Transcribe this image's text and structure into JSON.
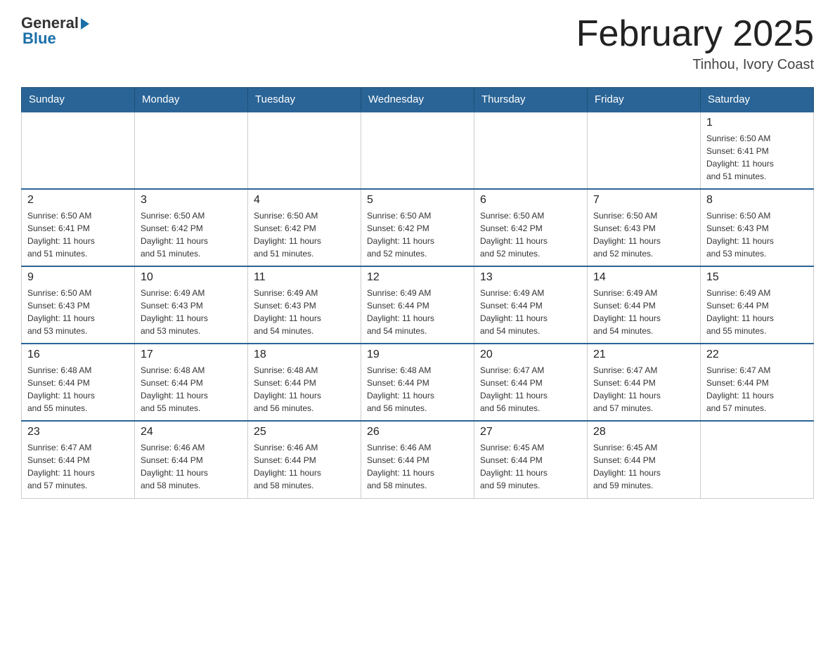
{
  "logo": {
    "general": "General",
    "blue": "Blue"
  },
  "title": "February 2025",
  "location": "Tinhou, Ivory Coast",
  "days_of_week": [
    "Sunday",
    "Monday",
    "Tuesday",
    "Wednesday",
    "Thursday",
    "Friday",
    "Saturday"
  ],
  "weeks": [
    [
      {
        "day": "",
        "info": ""
      },
      {
        "day": "",
        "info": ""
      },
      {
        "day": "",
        "info": ""
      },
      {
        "day": "",
        "info": ""
      },
      {
        "day": "",
        "info": ""
      },
      {
        "day": "",
        "info": ""
      },
      {
        "day": "1",
        "info": "Sunrise: 6:50 AM\nSunset: 6:41 PM\nDaylight: 11 hours\nand 51 minutes."
      }
    ],
    [
      {
        "day": "2",
        "info": "Sunrise: 6:50 AM\nSunset: 6:41 PM\nDaylight: 11 hours\nand 51 minutes."
      },
      {
        "day": "3",
        "info": "Sunrise: 6:50 AM\nSunset: 6:42 PM\nDaylight: 11 hours\nand 51 minutes."
      },
      {
        "day": "4",
        "info": "Sunrise: 6:50 AM\nSunset: 6:42 PM\nDaylight: 11 hours\nand 51 minutes."
      },
      {
        "day": "5",
        "info": "Sunrise: 6:50 AM\nSunset: 6:42 PM\nDaylight: 11 hours\nand 52 minutes."
      },
      {
        "day": "6",
        "info": "Sunrise: 6:50 AM\nSunset: 6:42 PM\nDaylight: 11 hours\nand 52 minutes."
      },
      {
        "day": "7",
        "info": "Sunrise: 6:50 AM\nSunset: 6:43 PM\nDaylight: 11 hours\nand 52 minutes."
      },
      {
        "day": "8",
        "info": "Sunrise: 6:50 AM\nSunset: 6:43 PM\nDaylight: 11 hours\nand 53 minutes."
      }
    ],
    [
      {
        "day": "9",
        "info": "Sunrise: 6:50 AM\nSunset: 6:43 PM\nDaylight: 11 hours\nand 53 minutes."
      },
      {
        "day": "10",
        "info": "Sunrise: 6:49 AM\nSunset: 6:43 PM\nDaylight: 11 hours\nand 53 minutes."
      },
      {
        "day": "11",
        "info": "Sunrise: 6:49 AM\nSunset: 6:43 PM\nDaylight: 11 hours\nand 54 minutes."
      },
      {
        "day": "12",
        "info": "Sunrise: 6:49 AM\nSunset: 6:44 PM\nDaylight: 11 hours\nand 54 minutes."
      },
      {
        "day": "13",
        "info": "Sunrise: 6:49 AM\nSunset: 6:44 PM\nDaylight: 11 hours\nand 54 minutes."
      },
      {
        "day": "14",
        "info": "Sunrise: 6:49 AM\nSunset: 6:44 PM\nDaylight: 11 hours\nand 54 minutes."
      },
      {
        "day": "15",
        "info": "Sunrise: 6:49 AM\nSunset: 6:44 PM\nDaylight: 11 hours\nand 55 minutes."
      }
    ],
    [
      {
        "day": "16",
        "info": "Sunrise: 6:48 AM\nSunset: 6:44 PM\nDaylight: 11 hours\nand 55 minutes."
      },
      {
        "day": "17",
        "info": "Sunrise: 6:48 AM\nSunset: 6:44 PM\nDaylight: 11 hours\nand 55 minutes."
      },
      {
        "day": "18",
        "info": "Sunrise: 6:48 AM\nSunset: 6:44 PM\nDaylight: 11 hours\nand 56 minutes."
      },
      {
        "day": "19",
        "info": "Sunrise: 6:48 AM\nSunset: 6:44 PM\nDaylight: 11 hours\nand 56 minutes."
      },
      {
        "day": "20",
        "info": "Sunrise: 6:47 AM\nSunset: 6:44 PM\nDaylight: 11 hours\nand 56 minutes."
      },
      {
        "day": "21",
        "info": "Sunrise: 6:47 AM\nSunset: 6:44 PM\nDaylight: 11 hours\nand 57 minutes."
      },
      {
        "day": "22",
        "info": "Sunrise: 6:47 AM\nSunset: 6:44 PM\nDaylight: 11 hours\nand 57 minutes."
      }
    ],
    [
      {
        "day": "23",
        "info": "Sunrise: 6:47 AM\nSunset: 6:44 PM\nDaylight: 11 hours\nand 57 minutes."
      },
      {
        "day": "24",
        "info": "Sunrise: 6:46 AM\nSunset: 6:44 PM\nDaylight: 11 hours\nand 58 minutes."
      },
      {
        "day": "25",
        "info": "Sunrise: 6:46 AM\nSunset: 6:44 PM\nDaylight: 11 hours\nand 58 minutes."
      },
      {
        "day": "26",
        "info": "Sunrise: 6:46 AM\nSunset: 6:44 PM\nDaylight: 11 hours\nand 58 minutes."
      },
      {
        "day": "27",
        "info": "Sunrise: 6:45 AM\nSunset: 6:44 PM\nDaylight: 11 hours\nand 59 minutes."
      },
      {
        "day": "28",
        "info": "Sunrise: 6:45 AM\nSunset: 6:44 PM\nDaylight: 11 hours\nand 59 minutes."
      },
      {
        "day": "",
        "info": ""
      }
    ]
  ]
}
